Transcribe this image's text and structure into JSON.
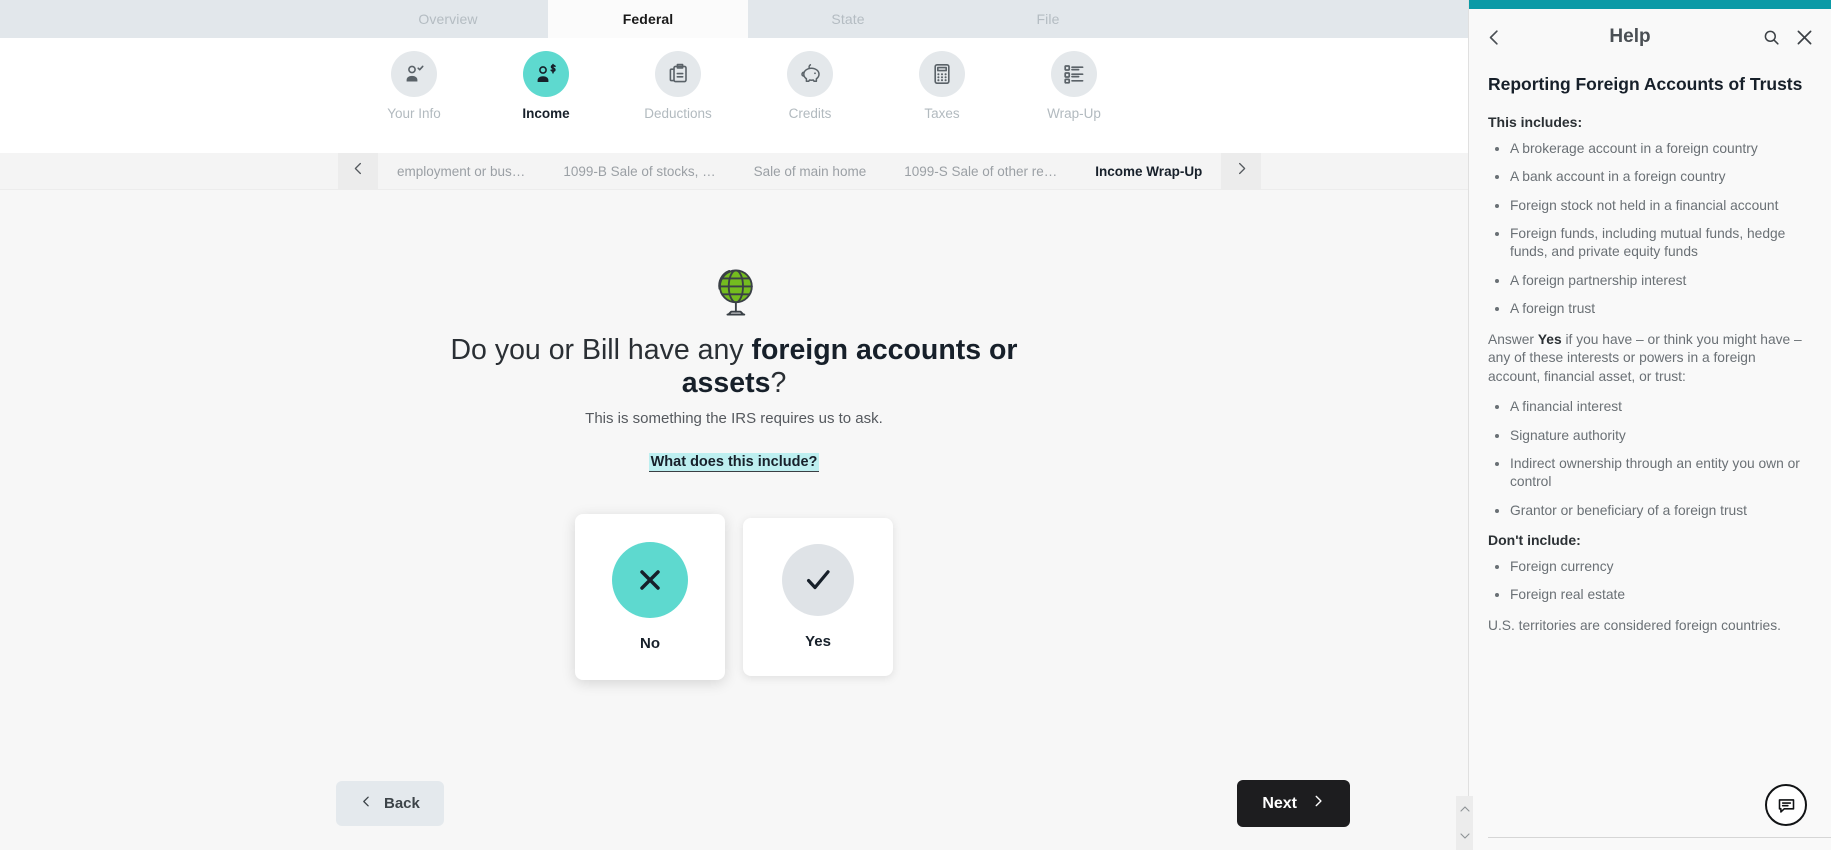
{
  "tabs": [
    {
      "label": "Overview",
      "active": false
    },
    {
      "label": "Federal",
      "active": true
    },
    {
      "label": "State",
      "active": false
    },
    {
      "label": "File",
      "active": false
    }
  ],
  "steps": [
    {
      "label": "Your Info",
      "icon": "person-check-icon",
      "active": false
    },
    {
      "label": "Income",
      "icon": "person-dollar-icon",
      "active": true
    },
    {
      "label": "Deductions",
      "icon": "clipboard-icon",
      "active": false
    },
    {
      "label": "Credits",
      "icon": "piggy-bank-icon",
      "active": false
    },
    {
      "label": "Taxes",
      "icon": "calculator-icon",
      "active": false
    },
    {
      "label": "Wrap-Up",
      "icon": "checklist-icon",
      "active": false
    }
  ],
  "subnav": {
    "prev_icon": "chevron-left-icon",
    "next_icon": "chevron-right-icon",
    "items": [
      {
        "label": "employment or bus…",
        "active": false
      },
      {
        "label": "1099-B Sale of stocks, …",
        "active": false
      },
      {
        "label": "Sale of main home",
        "active": false
      },
      {
        "label": "1099-S Sale of other re…",
        "active": false
      },
      {
        "label": "Income Wrap-Up",
        "active": true
      }
    ]
  },
  "question": {
    "illustration": "globe-icon",
    "title_lead": "Do you or Bill have any ",
    "title_bold": "foreign accounts or assets",
    "title_tail": "?",
    "subtitle": "This is something the IRS requires us to ask.",
    "link": "What does this include?",
    "choices": [
      {
        "label": "No",
        "icon": "x-icon",
        "selected": true
      },
      {
        "label": "Yes",
        "icon": "check-icon",
        "selected": false
      }
    ]
  },
  "footer": {
    "back_label": "Back",
    "back_icon": "chevron-left-icon",
    "next_label": "Next",
    "next_icon": "chevron-right-icon"
  },
  "help": {
    "back_icon": "chevron-left-icon",
    "title": "Help",
    "search_icon": "search-icon",
    "close_icon": "close-icon",
    "heading": "Reporting Foreign Accounts of Trusts",
    "includes_label": "This includes:",
    "includes": [
      "A brokerage account in a foreign country",
      "A bank account in a foreign country",
      "Foreign stock not held in a financial account",
      "Foreign funds, including mutual funds, hedge funds, and private equity funds",
      "A foreign partnership interest",
      "A foreign trust"
    ],
    "answer_lead": "Answer ",
    "answer_bold": "Yes",
    "answer_tail": " if you have – or think you might have – any of these interests or powers in a foreign account, financial asset, or trust:",
    "powers": [
      "A financial interest",
      "Signature authority",
      "Indirect ownership through an entity you own or control",
      "Grantor or beneficiary of a foreign trust"
    ],
    "dont_label": "Don't include:",
    "dont": [
      "Foreign currency",
      "Foreign real estate"
    ],
    "note": "U.S. territories are considered foreign countries.",
    "chat_icon": "chat-bubble-icon",
    "scroll_up_icon": "chevron-up-icon",
    "scroll_down_icon": "chevron-down-icon"
  },
  "colors": {
    "accent_teal": "#5ed9cf",
    "help_bar_teal": "#0b9aa6",
    "link_highlight": "#bdeff0",
    "next_button": "#1d1d1f",
    "globe_green": "#74bc1f"
  }
}
